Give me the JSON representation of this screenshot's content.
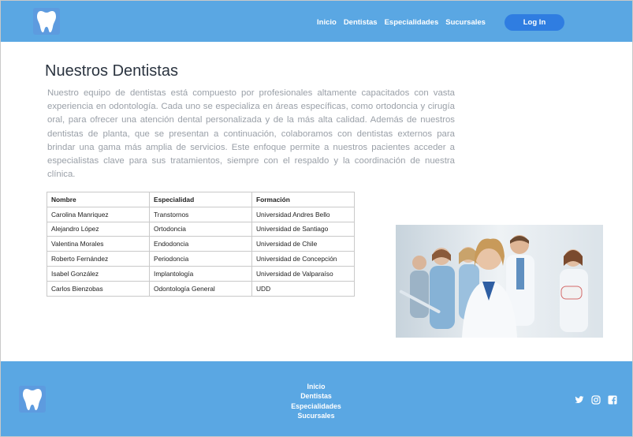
{
  "header": {
    "logo_icon": "tooth-icon",
    "nav": [
      "Inicio",
      "Dentistas",
      "Especialidades",
      "Sucursales"
    ],
    "login_label": "Log In"
  },
  "main": {
    "title": "Nuestros Dentistas",
    "intro": "Nuestro equipo de dentistas está compuesto por profesionales altamente capacitados con vasta experiencia en odontología. Cada uno se especializa en áreas específicas, como ortodoncia y cirugía oral, para ofrecer una atención dental personalizada y de la más alta calidad. Además de nuestros dentistas de planta, que se presentan a continuación, colaboramos con dentistas externos para brindar una gama más amplia de servicios. Este enfoque permite a nuestros pacientes acceder a especialistas clave para sus tratamientos, siempre con el respaldo y la coordinación de nuestra clínica.",
    "table": {
      "headers": [
        "Nombre",
        "Especialidad",
        "Formación"
      ],
      "rows": [
        [
          "Carolina Manriquez",
          "Transtornos",
          "Universidad Andres Bello"
        ],
        [
          "Alejandro López",
          "Ortodoncia",
          "Universidad de Santiago"
        ],
        [
          "Valentina Morales",
          "Endodoncia",
          "Universidad de Chile"
        ],
        [
          "Roberto Fernández",
          "Periodoncia",
          "Universidad de Concepción"
        ],
        [
          "Isabel González",
          "Implantología",
          "Universidad de Valparaíso"
        ],
        [
          "Carlos Bienzobas",
          "Odontología General",
          "UDD"
        ]
      ]
    }
  },
  "footer": {
    "nav": [
      "Inicio",
      "Dentistas",
      "Especialidades",
      "Sucursales"
    ],
    "social_icons": [
      "twitter-icon",
      "instagram-icon",
      "facebook-icon"
    ]
  },
  "colors": {
    "primary": "#5aa7e3",
    "button": "#2f7de1",
    "logo_bg": "#5d9bdf"
  }
}
